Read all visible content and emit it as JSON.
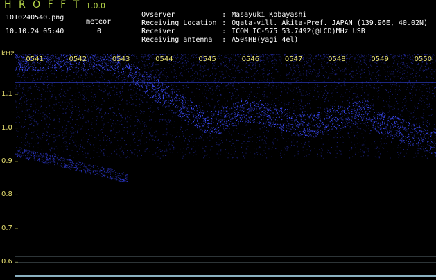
{
  "header": {
    "app_title": "H R O F F T",
    "app_version": "1.0.0",
    "file_name": "1010240540.png",
    "timestamp": "10.10.24 05:40",
    "meteor_label": "meteor",
    "meteor_count": "0"
  },
  "info": [
    {
      "key": "Ovserver",
      "sep": ":",
      "value": "Masayuki Kobayashi"
    },
    {
      "key": "Receiving Location",
      "sep": ":",
      "value": "Ogata-vill. Akita-Pref. JAPAN (139.96E, 40.02N)"
    },
    {
      "key": "Receiver",
      "sep": ":",
      "value": "ICOM IC-575 53.7492(@LCD)MHz USB"
    },
    {
      "key": "Receiving antenna",
      "sep": ":",
      "value": "A504HB(yagi 4el)"
    }
  ],
  "plot": {
    "unit_label": "kHz",
    "y_ticks": [
      "1.1",
      "1.0",
      "0.9",
      "0.8",
      "0.7",
      "0.6"
    ],
    "y_tick_values": [
      1.1,
      1.0,
      0.9,
      0.8,
      0.7,
      0.6
    ],
    "time_labels": [
      "0541",
      "0542",
      "0543",
      "0544",
      "0545",
      "0546",
      "0547",
      "0548",
      "0549",
      "0550"
    ],
    "time_values": [
      1,
      2,
      3,
      4,
      5,
      6,
      7,
      8,
      9,
      10
    ],
    "y_range": [
      0.58,
      1.22
    ],
    "x_range": [
      0.4,
      10.15
    ],
    "colors": {
      "background": "#000000",
      "signal": "#3c4cff",
      "grid": "#7a7a30",
      "axis_text": "#e8e070",
      "header_accent": "#b8d84a",
      "marker_line": "#8ab0c0"
    }
  }
}
